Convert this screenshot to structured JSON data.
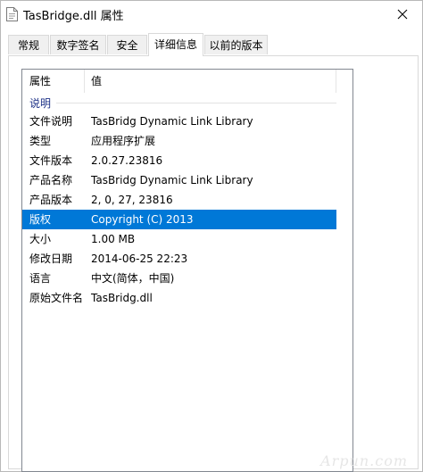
{
  "window": {
    "title": "TasBridge.dll 属性"
  },
  "tabs": [
    {
      "label": "常规"
    },
    {
      "label": "数字签名"
    },
    {
      "label": "安全"
    },
    {
      "label": "详细信息"
    },
    {
      "label": "以前的版本"
    }
  ],
  "active_tab": "详细信息",
  "list": {
    "header": {
      "col_property": "属性",
      "col_value": "值"
    },
    "group_label": "说明",
    "rows": [
      {
        "key": "文件说明",
        "value": "TasBridg Dynamic Link Library"
      },
      {
        "key": "类型",
        "value": "应用程序扩展"
      },
      {
        "key": "文件版本",
        "value": "2.0.27.23816"
      },
      {
        "key": "产品名称",
        "value": "TasBridg Dynamic Link Library"
      },
      {
        "key": "产品版本",
        "value": "2, 0, 27, 23816"
      },
      {
        "key": "版权",
        "value": "Copyright (C) 2013"
      },
      {
        "key": "大小",
        "value": "1.00 MB"
      },
      {
        "key": "修改日期",
        "value": "2014-06-25 22:23"
      },
      {
        "key": "语言",
        "value": "中文(简体，中国)"
      },
      {
        "key": "原始文件名",
        "value": "TasBridg.dll"
      }
    ],
    "selected_row": "版权"
  },
  "watermark": "Arpun.com",
  "colors": {
    "selection": "#0078d7",
    "group_label": "#1e3287",
    "border": "#d9d9d9"
  },
  "icons": {
    "file": "dll-file-icon",
    "close": "close-icon"
  }
}
